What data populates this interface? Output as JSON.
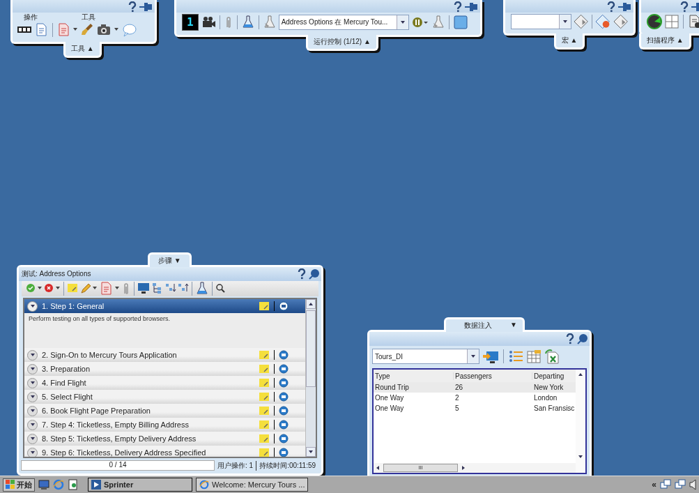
{
  "toolbars": [
    {
      "kind": "tools",
      "groups": [
        "操作",
        "工具"
      ],
      "tab": "工具 ▲"
    },
    {
      "kind": "run",
      "step": "1",
      "dropdown": "Address Options 在 Mercury Tou...",
      "tab": "运行控制 (1/12) ▲"
    },
    {
      "kind": "macro",
      "tab": "宏 ▲"
    },
    {
      "kind": "scan",
      "tab": "扫描程序 ▲"
    }
  ],
  "steps_panel": {
    "tab": "步骤 ▼",
    "title": "测试: Address Options",
    "steps": [
      {
        "label": "1. Step 1: General",
        "selected": true,
        "expanded": true,
        "description": "Perform testing on all types of supported browsers."
      },
      {
        "label": "2. Sign-On to Mercury Tours Application",
        "selected": false,
        "expanded": false
      },
      {
        "label": "3. Preparation",
        "selected": false,
        "expanded": false
      },
      {
        "label": "4. Find Flight",
        "selected": false,
        "expanded": false
      },
      {
        "label": "5. Select Flight",
        "selected": false,
        "expanded": false
      },
      {
        "label": "6. Book Flight Page Preparation",
        "selected": false,
        "expanded": false
      },
      {
        "label": "7. Step 4: Ticketless, Empty Billing Address",
        "selected": false,
        "expanded": false
      },
      {
        "label": "8. Step 5: Ticketless, Empty Delivery Address",
        "selected": false,
        "expanded": false
      },
      {
        "label": "9. Step 6: Ticketless, Delivery Address Specified",
        "selected": false,
        "expanded": false
      }
    ],
    "progress": "0 / 14",
    "level": 0,
    "user_actions": "用户操作: 1",
    "duration": "持续时间:00:11:59"
  },
  "data_panel": {
    "tab": "数据注入",
    "tab_arrow": "▼",
    "source": "Tours_DI",
    "columns": [
      "Type",
      "Passengers",
      "Departing"
    ],
    "rows": [
      {
        "cells": [
          "Round Trip",
          "26",
          "New York"
        ],
        "selected": true
      },
      {
        "cells": [
          "One Way",
          "2",
          "London"
        ],
        "selected": false
      },
      {
        "cells": [
          "One Way",
          "5",
          "San Fransisc"
        ],
        "selected": false
      }
    ],
    "scroll_grip": "III"
  },
  "taskbar": {
    "start": "开始",
    "tasks": [
      {
        "label": "Sprinter",
        "selected": true,
        "kind": "app"
      },
      {
        "label": "Welcome: Mercury Tours ...",
        "selected": false,
        "kind": "browser"
      }
    ],
    "tray_arrow": "«"
  }
}
